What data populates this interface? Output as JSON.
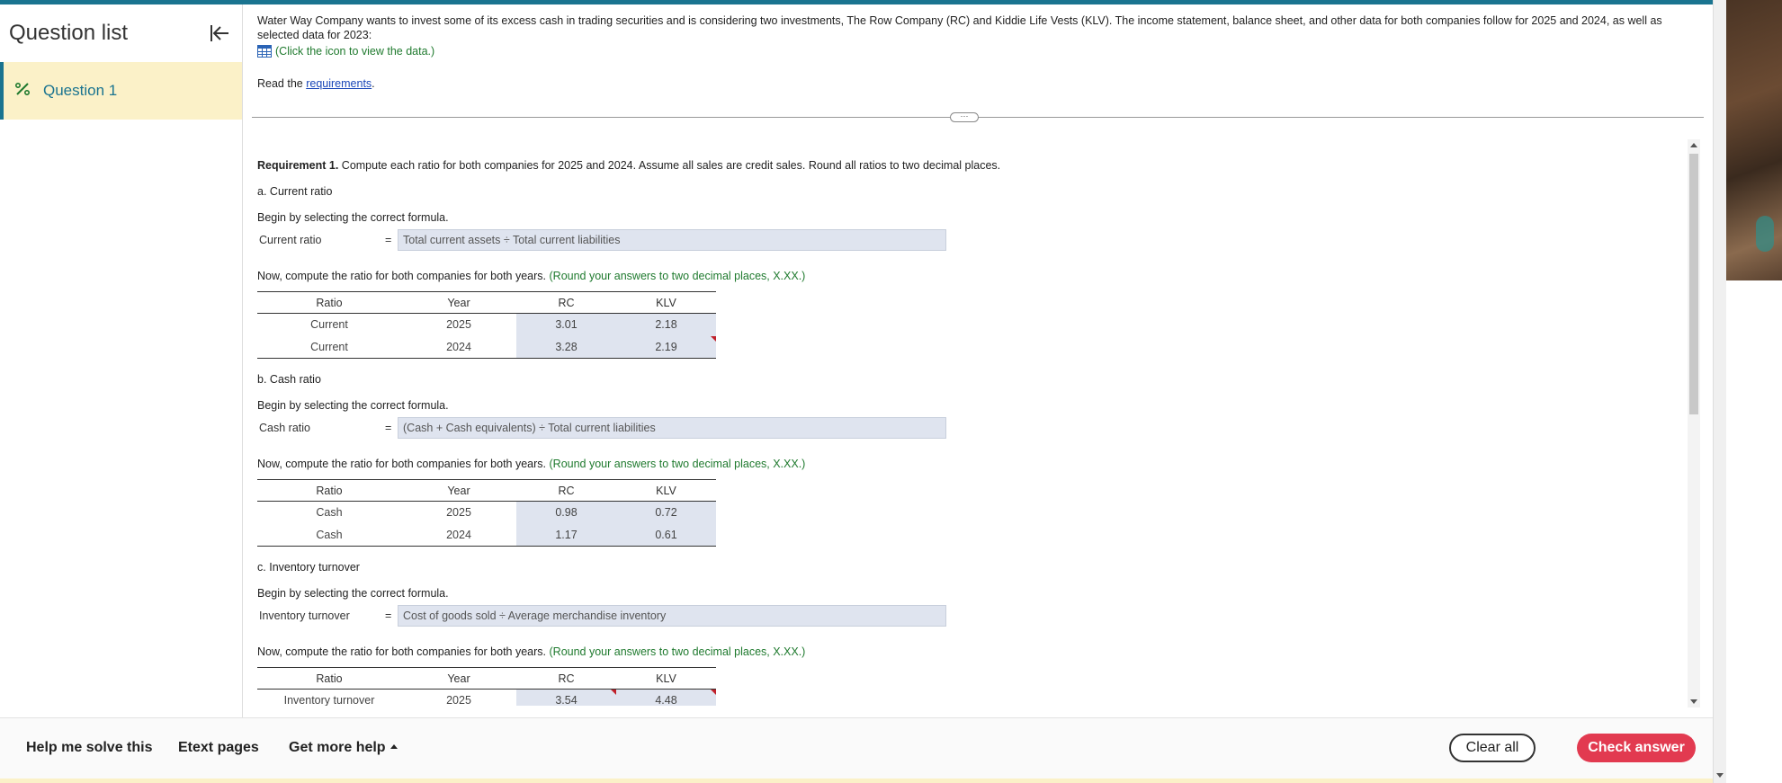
{
  "sidebar": {
    "title": "Question list",
    "items": [
      {
        "label": "Question 1"
      }
    ]
  },
  "intro": {
    "text": "Water Way Company wants to invest some of its excess cash in trading securities and is considering two investments, The Row Company (RC) and Kiddie Life Vests (KLV). The income statement, balance sheet, and other data for both companies follow for 2025 and 2024, as well as selected data for 2023:",
    "data_link": "(Click the icon to view the data.)",
    "read_prefix": "Read the ",
    "requirements_link": "requirements",
    "read_suffix": "."
  },
  "requirement": {
    "label": "Requirement 1.",
    "text": " Compute each ratio for both companies for 2025 and 2024. Assume all sales are credit sales. Round all ratios to two decimal places."
  },
  "instructions": {
    "select_formula": "Begin by selecting the correct formula.",
    "compute": "Now, compute the ratio for both companies for both years.",
    "round_hint": "(Round your answers to two decimal places, X.XX.)"
  },
  "table_headers": {
    "ratio": "Ratio",
    "year": "Year",
    "rc": "RC",
    "klv": "KLV"
  },
  "sections": [
    {
      "letter": "a.",
      "title": "Current ratio",
      "formula_label": "Current ratio",
      "formula": "Total current assets ÷ Total current liabilities",
      "rows": [
        {
          "ratio": "Current",
          "year": "2025",
          "rc": "3.01",
          "klv": "2.18"
        },
        {
          "ratio": "Current",
          "year": "2024",
          "rc": "3.28",
          "klv": "2.19"
        }
      ]
    },
    {
      "letter": "b.",
      "title": "Cash ratio",
      "formula_label": "Cash ratio",
      "formula": "(Cash + Cash equivalents) ÷ Total current liabilities",
      "rows": [
        {
          "ratio": "Cash",
          "year": "2025",
          "rc": "0.98",
          "klv": "0.72"
        },
        {
          "ratio": "Cash",
          "year": "2024",
          "rc": "1.17",
          "klv": "0.61"
        }
      ]
    },
    {
      "letter": "c.",
      "title": "Inventory turnover",
      "formula_label": "Inventory turnover",
      "formula": "Cost of goods sold ÷ Average merchandise inventory",
      "rows": [
        {
          "ratio": "Inventory turnover",
          "year": "2025",
          "rc": "3.54",
          "klv": "4.48"
        }
      ]
    }
  ],
  "equals": "=",
  "footer": {
    "help": "Help me solve this",
    "etext": "Etext pages",
    "more_help": "Get more help",
    "clear": "Clear all",
    "check": "Check answer"
  },
  "colors": {
    "accent": "#1a7490",
    "check": "#e23a50",
    "input_bg": "#dfe4ef",
    "hint": "#1f7a2e",
    "highlight": "#fbf1c8"
  }
}
